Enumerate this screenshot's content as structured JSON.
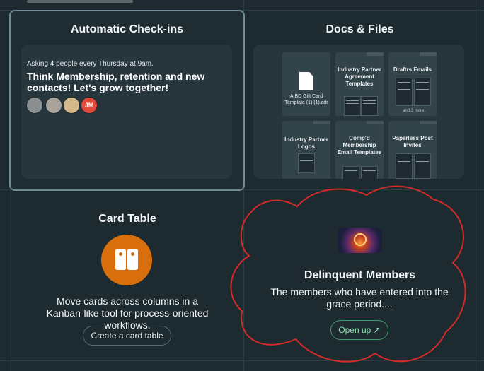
{
  "checkins": {
    "title": "Automatic Check-ins",
    "schedule": "Asking 4 people every Thursday at 9am.",
    "question": "Think Membership, retention and new contacts! Let's grow together!",
    "avatars": [
      {
        "name": "avatar-1",
        "color": "#8a8f92"
      },
      {
        "name": "avatar-2",
        "color": "#a9a39b"
      },
      {
        "name": "avatar-3",
        "color": "#d6b98b"
      },
      {
        "name": "avatar-jm",
        "color": "#e2493a",
        "initials": "JM"
      }
    ]
  },
  "docs": {
    "title": "Docs & Files",
    "items": [
      {
        "label": "AIBD Gift Card Template (1) (1).cdr",
        "kind": "file"
      },
      {
        "label": "Industry Partner Agreement Templates",
        "kind": "folder"
      },
      {
        "label": "Draftrs Emails",
        "kind": "folder",
        "more": "and 3 more."
      },
      {
        "label": "Industry Partner Logos",
        "kind": "folder"
      },
      {
        "label": "Comp'd Membership Email Templates",
        "kind": "folder"
      },
      {
        "label": "Paperless Post Invites",
        "kind": "folder"
      }
    ]
  },
  "card_table": {
    "title": "Card Table",
    "description": "Move cards across columns in a Kanban-like tool for process-oriented workflows.",
    "button": "Create a card table"
  },
  "delinquent": {
    "title": "Delinquent Members",
    "description": "The members who have entered into the grace period....",
    "button": "Open up ↗"
  },
  "colors": {
    "accent_orange": "#d96f0c",
    "annotation_red": "#d42a2a",
    "open_green": "#3f9f6a"
  }
}
